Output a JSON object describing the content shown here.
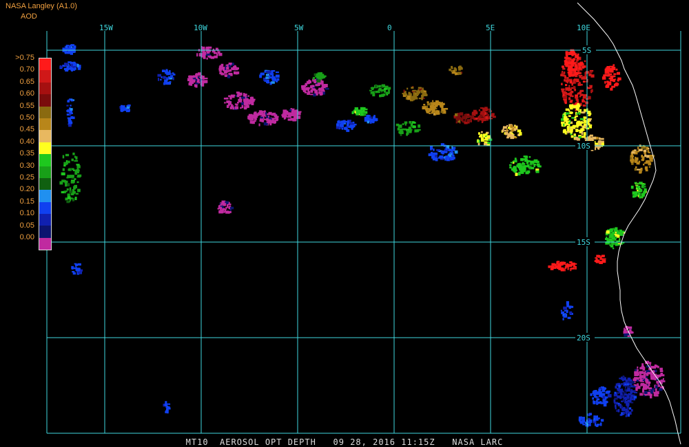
{
  "header": {
    "product": "NASA Langley (A1.0)",
    "parameter": "AOD"
  },
  "legend": {
    "labels": [
      ">0.75",
      "0.70",
      "0.65",
      "0.60",
      "0.55",
      "0.50",
      "0.45",
      "0.40",
      "0.35",
      "0.30",
      "0.25",
      "0.20",
      "0.15",
      "0.10",
      "0.05",
      "0.00"
    ],
    "colors": [
      "#ff1a1a",
      "#d01818",
      "#a51010",
      "#7a0c0c",
      "#8a6a10",
      "#b8861a",
      "#e8b860",
      "#ffff20",
      "#1ec81e",
      "#18a018",
      "#106010",
      "#2090f0",
      "#1040f0",
      "#1020b0",
      "#0c1470",
      "#c02aa0"
    ]
  },
  "grid": {
    "longitudes": [
      "15W",
      "10W",
      "5W",
      "0",
      "5E",
      "10E"
    ],
    "latitudes": [
      "5S",
      "10S",
      "15S",
      "20S"
    ]
  },
  "footer": {
    "satellite": "MT10",
    "product": "AEROSOL OPT DEPTH",
    "date": "09 28, 2016",
    "time": "11:15Z",
    "source": "NASA LARC"
  },
  "colors": {
    "grid": "#3fd9e0",
    "header_text": "#f0a040",
    "coast": "#ffffff"
  }
}
